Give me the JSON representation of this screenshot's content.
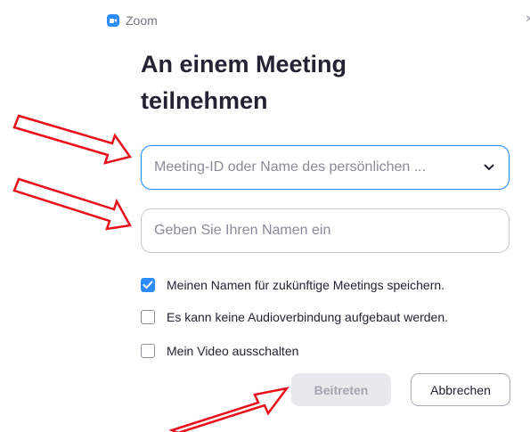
{
  "window": {
    "app_name": "Zoom",
    "app_icon": "zoom-camera-icon",
    "close_icon": "close-icon",
    "close_glyph": "×"
  },
  "title": "An einem Meeting teilnehmen",
  "meeting_field": {
    "placeholder": "Meeting-ID oder Name des persönlichen ...",
    "value": "",
    "dropdown_icon": "chevron-down-icon"
  },
  "name_field": {
    "placeholder": "Geben Sie Ihren Namen ein",
    "value": ""
  },
  "options": [
    {
      "label": "Meinen Namen für zukünftige Meetings speichern.",
      "checked": true
    },
    {
      "label": "Es kann keine Audioverbindung aufgebaut werden.",
      "checked": false
    },
    {
      "label": "Mein Video ausschalten",
      "checked": false
    }
  ],
  "buttons": {
    "join_label": "Beitreten",
    "join_enabled": false,
    "cancel_label": "Abbrechen"
  },
  "annotations": {
    "arrow_color": "#e8101a",
    "arrow_icon": "red-outline-arrow-icon"
  },
  "colors": {
    "accent": "#2d8cff",
    "text": "#232333",
    "muted": "#747487",
    "disabled_button_bg": "#e8e8ed"
  }
}
